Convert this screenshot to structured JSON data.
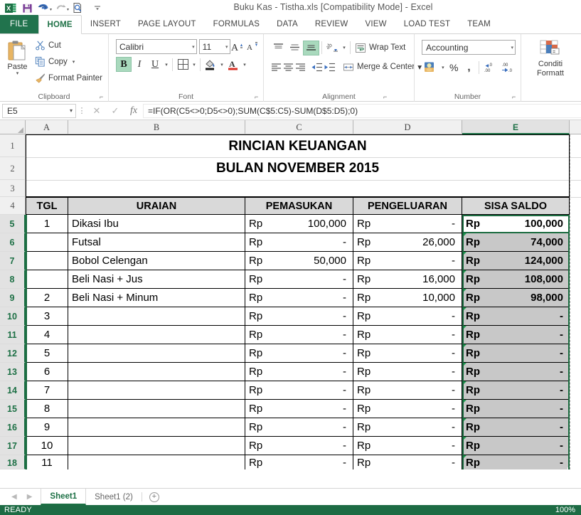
{
  "window": {
    "title": "Buku Kas - Tistha.xls  [Compatibility Mode] - Excel"
  },
  "quick_access": {
    "items": [
      {
        "name": "excel-logo-icon",
        "label": "X"
      },
      {
        "name": "save-icon",
        "label": "Save"
      },
      {
        "name": "undo-icon",
        "label": "Undo"
      },
      {
        "name": "redo-icon",
        "label": "Redo"
      },
      {
        "name": "print-preview-icon",
        "label": "Print Preview and Print"
      },
      {
        "name": "customize-qat-icon",
        "label": "Customize Quick Access Toolbar"
      }
    ]
  },
  "ribbon": {
    "tabs": [
      {
        "label": "FILE",
        "active": false
      },
      {
        "label": "HOME",
        "active": true
      },
      {
        "label": "INSERT",
        "active": false
      },
      {
        "label": "PAGE LAYOUT",
        "active": false
      },
      {
        "label": "FORMULAS",
        "active": false
      },
      {
        "label": "DATA",
        "active": false
      },
      {
        "label": "REVIEW",
        "active": false
      },
      {
        "label": "VIEW",
        "active": false
      },
      {
        "label": "LOAD TEST",
        "active": false
      },
      {
        "label": "TEAM",
        "active": false
      }
    ],
    "clipboard": {
      "group_label": "Clipboard",
      "paste_label": "Paste",
      "cut_label": "Cut",
      "copy_label": "Copy",
      "format_painter_label": "Format Painter"
    },
    "font": {
      "group_label": "Font",
      "font_family": "Calibri",
      "font_size": "11",
      "bold_label": "B",
      "italic_label": "I",
      "underline_label": "U",
      "grow_font_label": "A",
      "shrink_font_label": "A",
      "bold_active": true
    },
    "alignment": {
      "group_label": "Alignment",
      "wrap_text_label": "Wrap Text",
      "merge_center_label": "Merge & Center"
    },
    "number": {
      "group_label": "Number",
      "format_value": "Accounting",
      "percent_label": "%",
      "comma_label": ",",
      "increase_decimal_label": ".00",
      "decrease_decimal_label": ".00"
    },
    "styles": {
      "conditional_formatting_line1": "Conditi",
      "conditional_formatting_line2": "Formatt"
    }
  },
  "formula_bar": {
    "name_box": "E5",
    "cancel_label": "✕",
    "enter_label": "✓",
    "function_label": "fx",
    "formula": "=IF(OR(C5<>0;D5<>0);SUM(C$5:C5)-SUM(D$5:D5);0)"
  },
  "grid": {
    "columns": [
      "A",
      "B",
      "C",
      "D",
      "E"
    ],
    "selected_column": "E",
    "rows": [
      "1",
      "2",
      "3",
      "4",
      "5",
      "6",
      "7",
      "8",
      "9",
      "10",
      "11",
      "12",
      "13",
      "14",
      "15",
      "16",
      "17",
      "18"
    ],
    "selected_rows": [
      "5",
      "6",
      "7",
      "8",
      "9",
      "10",
      "11",
      "12",
      "13",
      "14",
      "15",
      "16",
      "17",
      "18"
    ],
    "active_cell": "E5",
    "titles": {
      "line1": "RINCIAN KEUANGAN",
      "line2": "BULAN NOVEMBER 2015"
    },
    "headers": [
      "TGL",
      "URAIAN",
      "PEMASUKAN",
      "PENGELUARAN",
      "SISA SALDO"
    ],
    "currency_symbol": "Rp",
    "dash": "-",
    "data_rows": [
      {
        "row": "5",
        "tgl": "1",
        "uraian": "Dikasi Ibu",
        "pemasukan": "100,000",
        "pengeluaran": "-",
        "saldo": "100,000"
      },
      {
        "row": "6",
        "tgl": "",
        "uraian": "Futsal",
        "pemasukan": "-",
        "pengeluaran": "26,000",
        "saldo": "74,000"
      },
      {
        "row": "7",
        "tgl": "",
        "uraian": "Bobol Celengan",
        "pemasukan": "50,000",
        "pengeluaran": "-",
        "saldo": "124,000"
      },
      {
        "row": "8",
        "tgl": "",
        "uraian": "Beli Nasi + Jus",
        "pemasukan": "-",
        "pengeluaran": "16,000",
        "saldo": "108,000"
      },
      {
        "row": "9",
        "tgl": "2",
        "uraian": "Beli Nasi + Minum",
        "pemasukan": "-",
        "pengeluaran": "10,000",
        "saldo": "98,000"
      },
      {
        "row": "10",
        "tgl": "3",
        "uraian": "",
        "pemasukan": "-",
        "pengeluaran": "-",
        "saldo": "-"
      },
      {
        "row": "11",
        "tgl": "4",
        "uraian": "",
        "pemasukan": "-",
        "pengeluaran": "-",
        "saldo": "-"
      },
      {
        "row": "12",
        "tgl": "5",
        "uraian": "",
        "pemasukan": "-",
        "pengeluaran": "-",
        "saldo": "-"
      },
      {
        "row": "13",
        "tgl": "6",
        "uraian": "",
        "pemasukan": "-",
        "pengeluaran": "-",
        "saldo": "-"
      },
      {
        "row": "14",
        "tgl": "7",
        "uraian": "",
        "pemasukan": "-",
        "pengeluaran": "-",
        "saldo": "-"
      },
      {
        "row": "15",
        "tgl": "8",
        "uraian": "",
        "pemasukan": "-",
        "pengeluaran": "-",
        "saldo": "-"
      },
      {
        "row": "16",
        "tgl": "9",
        "uraian": "",
        "pemasukan": "-",
        "pengeluaran": "-",
        "saldo": "-"
      },
      {
        "row": "17",
        "tgl": "10",
        "uraian": "",
        "pemasukan": "-",
        "pengeluaran": "-",
        "saldo": "-"
      },
      {
        "row": "18",
        "tgl": "11",
        "uraian": "",
        "pemasukan": "-",
        "pengeluaran": "-",
        "saldo": "-"
      }
    ]
  },
  "sheet_tabs": {
    "tabs": [
      {
        "label": "Sheet1",
        "active": true
      },
      {
        "label": "Sheet1 (2)",
        "active": false
      }
    ],
    "add_sheet_label": "+",
    "prev_label": "◀",
    "next_label": "▶"
  },
  "status_bar": {
    "left": "READY",
    "right": "100%"
  },
  "colors": {
    "excel_green": "#21734d",
    "selection_green": "#1a6b3f",
    "header_fill": "#d9d9d9",
    "selected_fill": "#c8c8c8"
  }
}
